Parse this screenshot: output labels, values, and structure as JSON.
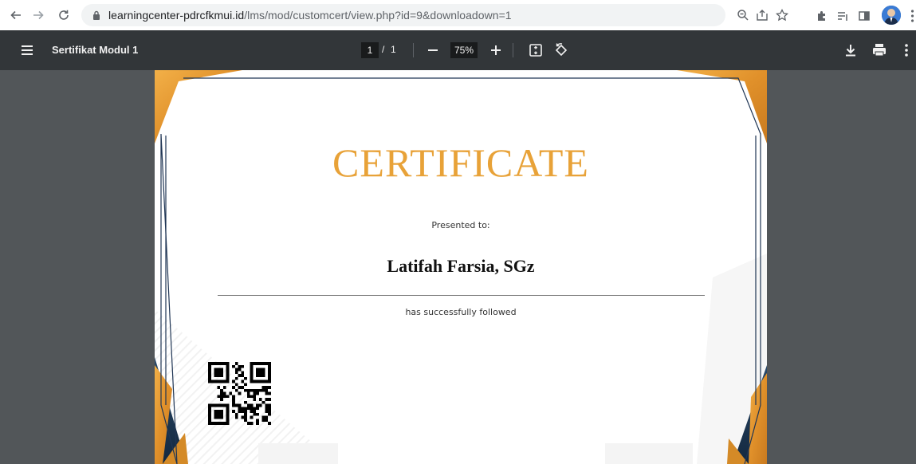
{
  "browser": {
    "url_domain": "learningcenter-pdrcfkmui.id",
    "url_path": "/lms/mod/customcert/view.php?id=9&downloadown=1"
  },
  "pdf_toolbar": {
    "title": "Sertifikat Modul 1",
    "page_current": "1",
    "page_separator": "/",
    "page_total": "1",
    "zoom": "75%"
  },
  "certificate": {
    "heading": "CERTIFICATE",
    "presented_label": "Presented to:",
    "recipient": "Latifah Farsia, SGz",
    "followed_label": "has successfully followed"
  },
  "colors": {
    "accent_gold": "#e8a238",
    "frame_navy": "#1f3554",
    "pdf_toolbar_bg": "#323639",
    "viewer_bg": "#525659"
  },
  "icons": [
    "back-arrow-icon",
    "forward-arrow-icon",
    "reload-icon",
    "lock-icon",
    "zoom-icon",
    "share-icon",
    "bookmark-star-icon",
    "extensions-icon",
    "reading-list-icon",
    "side-panel-icon",
    "kebab-menu-icon",
    "hamburger-menu-icon",
    "minus-icon",
    "plus-icon",
    "fit-page-icon",
    "rotate-icon",
    "download-icon",
    "print-icon"
  ]
}
